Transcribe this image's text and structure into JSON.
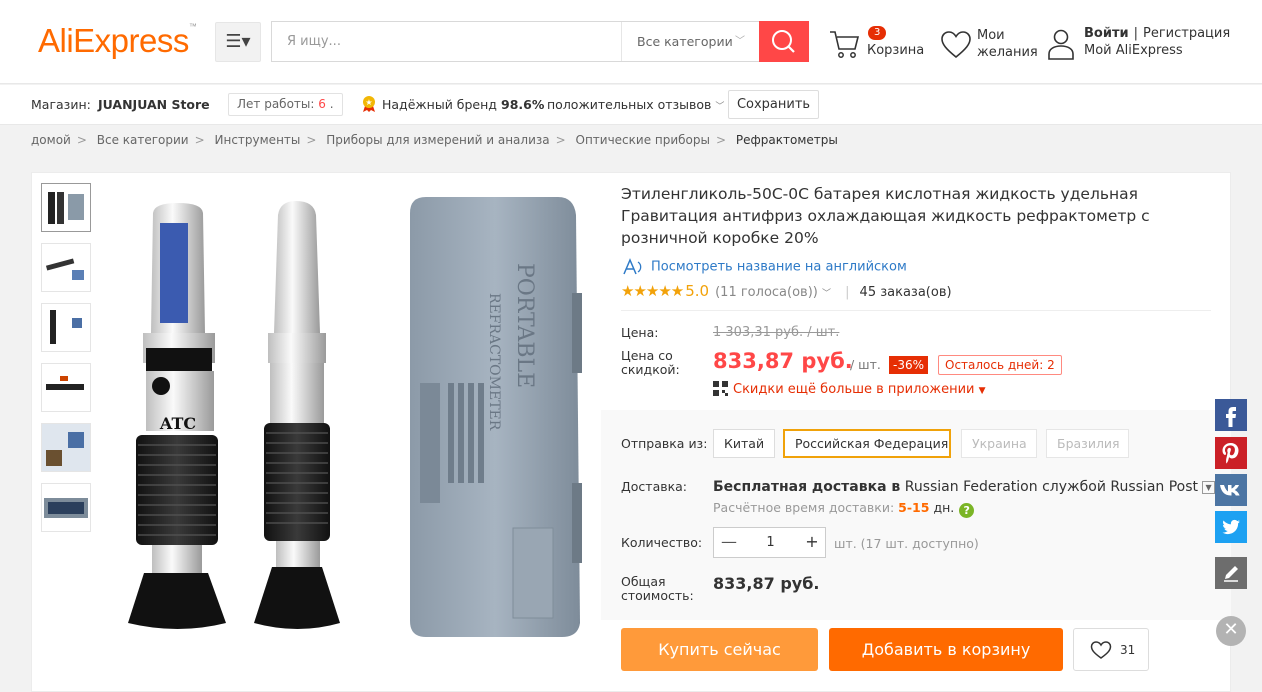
{
  "header": {
    "logo": "AliExpress",
    "menu_icon": "hamburger-icon",
    "search_placeholder": "Я ищу...",
    "search_category": "Все категории",
    "cart_count": "3",
    "cart_label": "Корзина",
    "wishlist_line1": "Мои",
    "wishlist_line2": "желания",
    "login": "Войти",
    "separator": "|",
    "register": "Регистрация",
    "my_account": "Мой AliExpress"
  },
  "store": {
    "label": "Магазин:",
    "name": "JUANJUAN Store",
    "years_label": "Лет работы:",
    "years_value": "6",
    "brand": "Надёжный бренд",
    "positive_pct": "98.6%",
    "positive_label": "положительных отзывов",
    "save": "Сохранить"
  },
  "breadcrumbs": [
    "домой",
    "Все категории",
    "Инструменты",
    "Приборы для измерений и анализа",
    "Оптические приборы",
    "Рефрактометры"
  ],
  "breadcrumb_sep": ">",
  "product": {
    "title": "Этиленгликоль-50С-0С батарея кислотная жидкость удельная Гравитация антифриз охлаждающая жидкость рефрактометр с розничной коробке 20%",
    "view_english": "Посмотреть название на английском",
    "stars": "★★★★★",
    "rating": "5.0",
    "votes": "(11 голоса(ов))",
    "orders": "45 заказа(ов)",
    "price_label": "Цена:",
    "old_price": "1 303,31 руб. / шт.",
    "disc_label_1": "Цена со",
    "disc_label_2": "скидкой:",
    "price": "833,87 руб.",
    "unit": "/ шт.",
    "discount": "-36%",
    "days_left": "Осталось дней: 2",
    "app_discount": "Скидки ещё больше в приложении",
    "ship_from_label": "Отправка из:",
    "ship_from": [
      "Китай",
      "Российская Федерация",
      "Украина",
      "Бразилия"
    ],
    "delivery_label": "Доставка:",
    "delivery_free": "Бесплатная доставка в",
    "delivery_country": "Russian Federation",
    "delivery_service": "службой",
    "delivery_carrier": "Russian Post",
    "delivery_time_label": "Расчётное время доставки:",
    "delivery_time": "5-15",
    "delivery_days": "дн.",
    "qty_label": "Количество:",
    "qty": "1",
    "available": "шт. (17 шт. доступно)",
    "total_label_1": "Общая",
    "total_label_2": "стоимость:",
    "total": "833,87 руб.",
    "buy_now": "Купить сейчас",
    "add_to_cart": "Добавить в корзину",
    "wish_count": "31",
    "image_text_1": "ATC",
    "image_text_2": "PORTABLE",
    "image_text_3": "REFRACTOMETER"
  },
  "colors": {
    "brand_orange": "#ff6a00",
    "red": "#ff4747",
    "star": "#f2a20a"
  }
}
